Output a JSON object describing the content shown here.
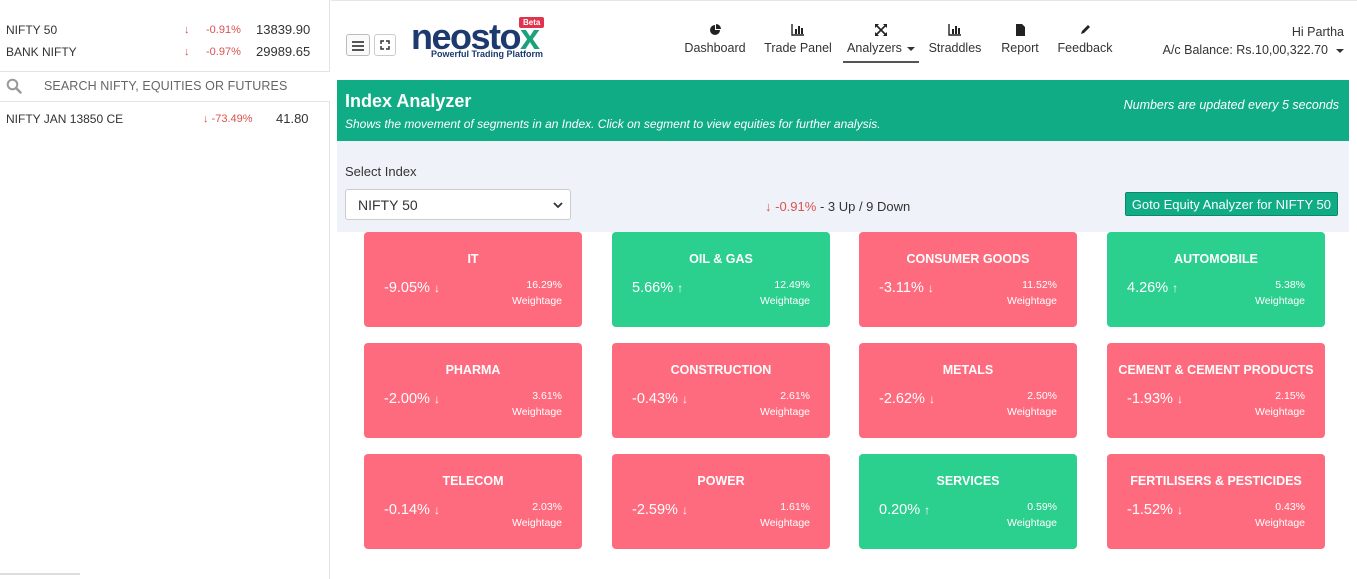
{
  "tickers": [
    {
      "name": "NIFTY 50",
      "arrow": "↓",
      "change": "-0.91%",
      "price": "13839.90"
    },
    {
      "name": "BANK NIFTY",
      "arrow": "↓",
      "change": "-0.97%",
      "price": "29989.65"
    }
  ],
  "search": {
    "placeholder": "SEARCH NIFTY, EQUITIES OR FUTURES"
  },
  "watchlist": [
    {
      "name": "NIFTY JAN 13850 CE",
      "change": "↓ -73.49%",
      "price": "41.80"
    }
  ],
  "logo": {
    "main_left": "neosto",
    "main_x": "x",
    "tagline": "Powerful Trading Platform",
    "badge": "Beta"
  },
  "nav": [
    {
      "label": "Dashboard",
      "icon": "pie-chart-icon"
    },
    {
      "label": "Trade Panel",
      "icon": "bar-chart-icon"
    },
    {
      "label": "Analyzers",
      "icon": "arrows-icon",
      "active": true
    },
    {
      "label": "Straddles",
      "icon": "bar-chart-icon"
    },
    {
      "label": "Report",
      "icon": "file-icon"
    },
    {
      "label": "Feedback",
      "icon": "pencil-icon"
    }
  ],
  "user": {
    "greeting": "Hi Partha",
    "balance": "A/c Balance: Rs.10,00,322.70"
  },
  "banner": {
    "title": "Index Analyzer",
    "subtitle": "Shows the movement of segments in an Index. Click on segment to view equities for further analysis.",
    "note": "Numbers are updated every 5 seconds"
  },
  "index_select": {
    "label": "Select Index",
    "value": "NIFTY 50"
  },
  "summary": {
    "arrow": "↓",
    "change": "-0.91%",
    "rest": " - 3 Up / 9 Down"
  },
  "goto_button": "Goto Equity Analyzer for NIFTY 50",
  "weight_label": "Weightage",
  "colors": {
    "negative": "#ff6b7e",
    "positive": "#2bcf8e",
    "banner": "#0fac85"
  },
  "segments": [
    {
      "name": "IT",
      "change": "-9.05%",
      "arrow": "↓",
      "weight": "16.29%",
      "direction": "down"
    },
    {
      "name": "OIL & GAS",
      "change": "5.66%",
      "arrow": "↑",
      "weight": "12.49%",
      "direction": "up"
    },
    {
      "name": "CONSUMER GOODS",
      "change": "-3.11%",
      "arrow": "↓",
      "weight": "11.52%",
      "direction": "down"
    },
    {
      "name": "AUTOMOBILE",
      "change": "4.26%",
      "arrow": "↑",
      "weight": "5.38%",
      "direction": "up"
    },
    {
      "name": "PHARMA",
      "change": "-2.00%",
      "arrow": "↓",
      "weight": "3.61%",
      "direction": "down"
    },
    {
      "name": "CONSTRUCTION",
      "change": "-0.43%",
      "arrow": "↓",
      "weight": "2.61%",
      "direction": "down"
    },
    {
      "name": "METALS",
      "change": "-2.62%",
      "arrow": "↓",
      "weight": "2.50%",
      "direction": "down"
    },
    {
      "name": "CEMENT & CEMENT PRODUCTS",
      "change": "-1.93%",
      "arrow": "↓",
      "weight": "2.15%",
      "direction": "down"
    },
    {
      "name": "TELECOM",
      "change": "-0.14%",
      "arrow": "↓",
      "weight": "2.03%",
      "direction": "down"
    },
    {
      "name": "POWER",
      "change": "-2.59%",
      "arrow": "↓",
      "weight": "1.61%",
      "direction": "down"
    },
    {
      "name": "SERVICES",
      "change": "0.20%",
      "arrow": "↑",
      "weight": "0.59%",
      "direction": "up"
    },
    {
      "name": "FERTILISERS & PESTICIDES",
      "change": "-1.52%",
      "arrow": "↓",
      "weight": "0.43%",
      "direction": "down"
    }
  ]
}
